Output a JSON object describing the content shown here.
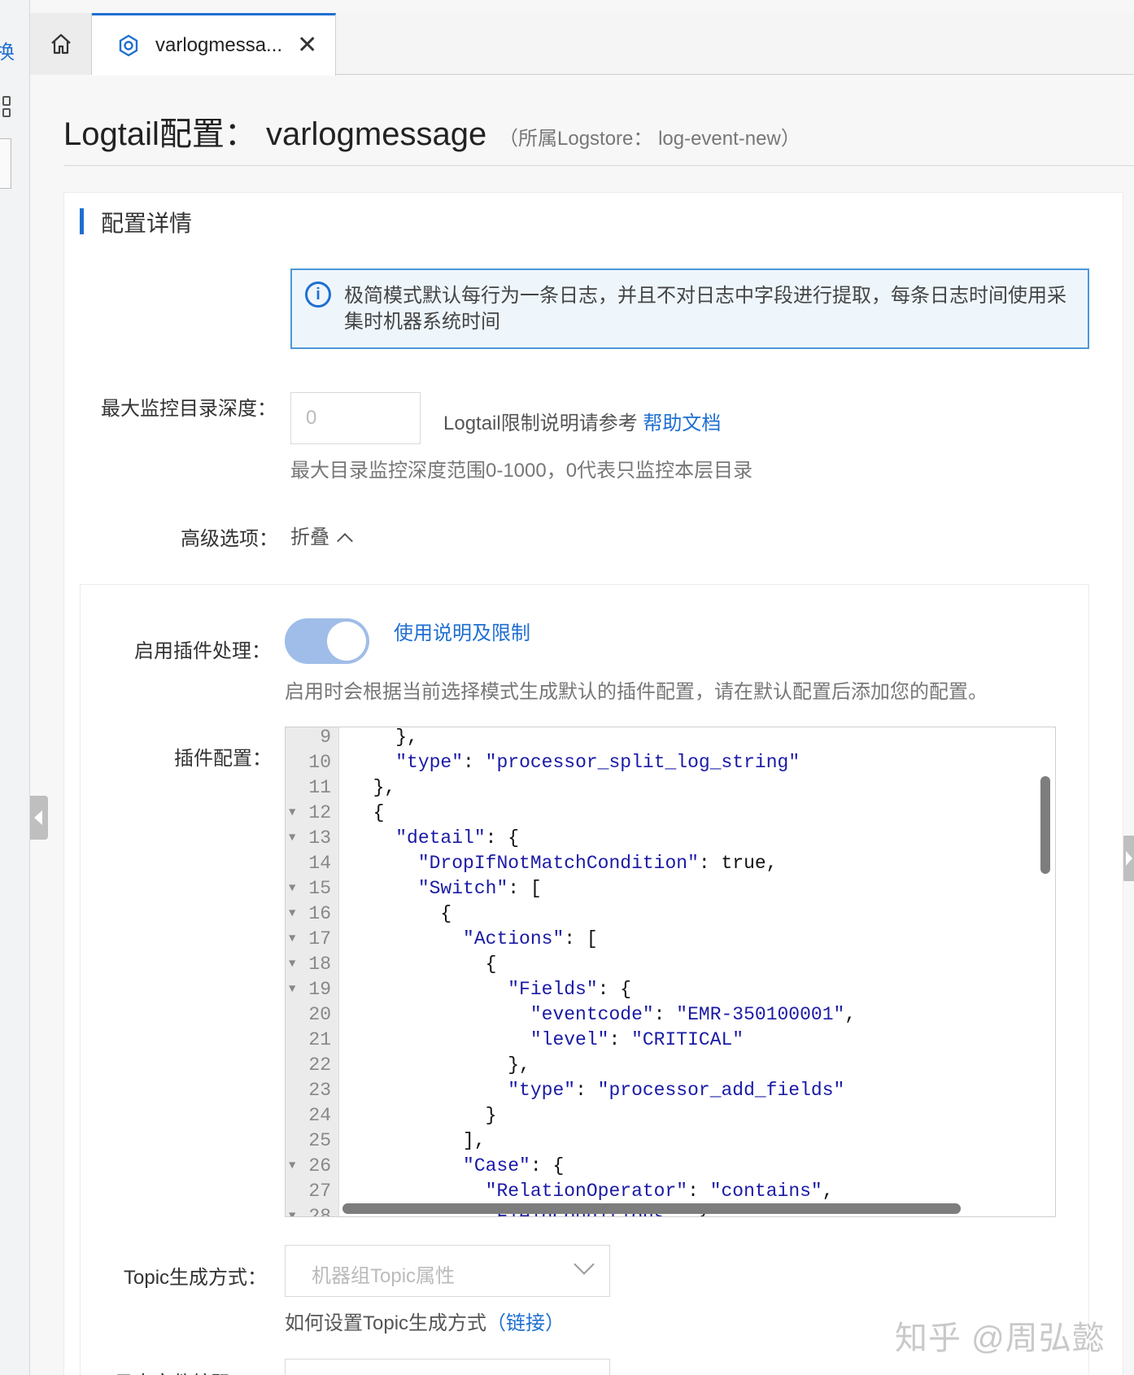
{
  "left_rail": {
    "top_glyph": "换"
  },
  "tabs": {
    "active_label": "varlogmessa...",
    "close_glyph": "✕"
  },
  "header": {
    "title": "Logtail配置：  varlogmessage",
    "subtitle": "（所属Logstore： log-event-new）"
  },
  "section": {
    "title": "配置详情"
  },
  "notice": {
    "text": "极简模式默认每行为一条日志，并且不对日志中字段进行提取，每条日志时间使用采集时机器系统时间"
  },
  "depth": {
    "label": "最大监控目录深度：",
    "placeholder": "0",
    "note": "Logtail限制说明请参考 ",
    "link": "帮助文档",
    "help": "最大目录监控深度范围0-1000，0代表只监控本层目录"
  },
  "advanced": {
    "label": "高级选项：",
    "toggle_text": "折叠"
  },
  "plugin": {
    "label": "启用插件处理：",
    "enabled": true,
    "link": "使用说明及限制",
    "help": "启用时会根据当前选择模式生成默认的插件配置，请在默认配置后添加您的配置。",
    "config_label": "插件配置：",
    "lines": [
      {
        "n": "9",
        "fold": false,
        "code": "    },"
      },
      {
        "n": "10",
        "fold": false,
        "code": "    \"type\": \"processor_split_log_string\""
      },
      {
        "n": "11",
        "fold": false,
        "code": "  },"
      },
      {
        "n": "12",
        "fold": true,
        "code": "  {"
      },
      {
        "n": "13",
        "fold": true,
        "code": "    \"detail\": {"
      },
      {
        "n": "14",
        "fold": false,
        "code": "      \"DropIfNotMatchCondition\": true,"
      },
      {
        "n": "15",
        "fold": true,
        "code": "      \"Switch\": ["
      },
      {
        "n": "16",
        "fold": true,
        "code": "        {"
      },
      {
        "n": "17",
        "fold": true,
        "code": "          \"Actions\": ["
      },
      {
        "n": "18",
        "fold": true,
        "code": "            {"
      },
      {
        "n": "19",
        "fold": true,
        "code": "              \"Fields\": {"
      },
      {
        "n": "20",
        "fold": false,
        "code": "                \"eventcode\": \"EMR-350100001\","
      },
      {
        "n": "21",
        "fold": false,
        "code": "                \"level\": \"CRITICAL\""
      },
      {
        "n": "22",
        "fold": false,
        "code": "              },"
      },
      {
        "n": "23",
        "fold": false,
        "code": "              \"type\": \"processor_add_fields\""
      },
      {
        "n": "24",
        "fold": false,
        "code": "            }"
      },
      {
        "n": "25",
        "fold": false,
        "code": "          ],"
      },
      {
        "n": "26",
        "fold": true,
        "code": "          \"Case\": {"
      },
      {
        "n": "27",
        "fold": false,
        "code": "            \"RelationOperator\": \"contains\","
      },
      {
        "n": "28",
        "fold": true,
        "code": "            \"FieldConditions\": {"
      }
    ]
  },
  "topic": {
    "label": "Topic生成方式：",
    "value": "机器组Topic属性",
    "help_text": "如何设置Topic生成方式",
    "help_link": "（链接）"
  },
  "next_field": {
    "label": "日志文件编码："
  },
  "watermark": "知乎 @周弘懿",
  "colors": {
    "accent": "#1f6fd1",
    "switch_on": "#9fbde8",
    "notice_bg": "#eef6fc"
  }
}
